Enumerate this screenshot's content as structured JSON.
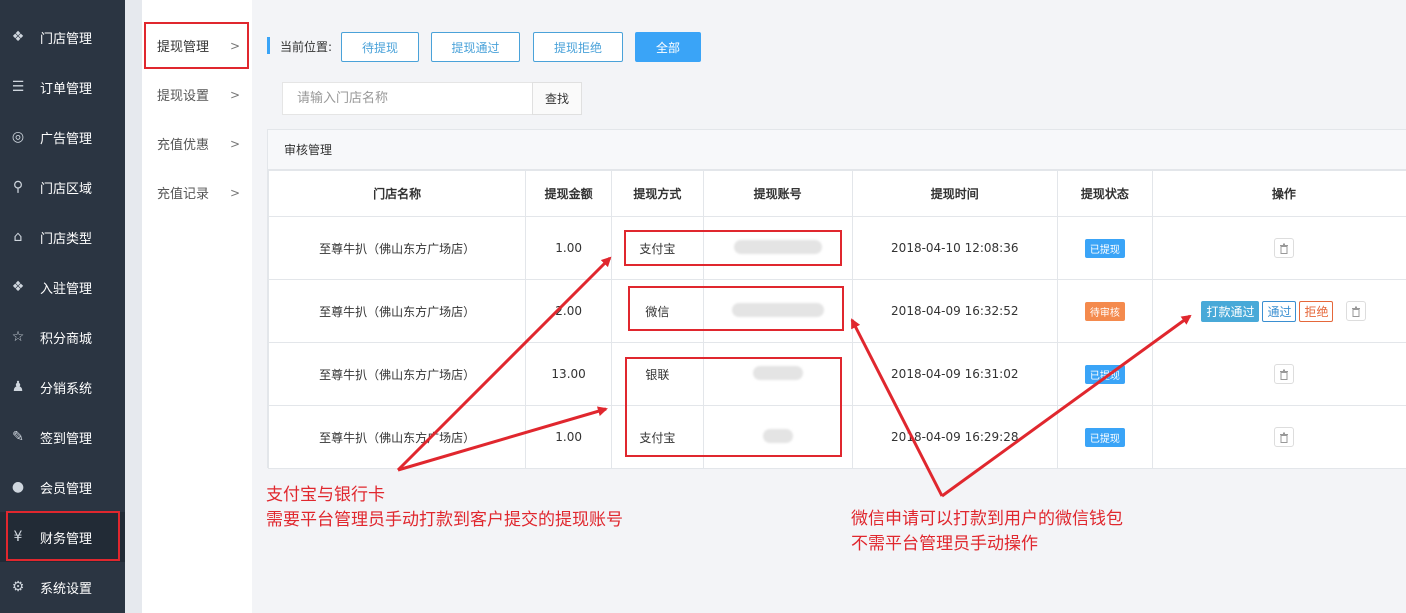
{
  "sidebar": {
    "items": [
      {
        "icon": "cubes-icon",
        "label": "门店管理"
      },
      {
        "icon": "list-icon",
        "label": "订单管理"
      },
      {
        "icon": "lifebuoy-icon",
        "label": "广告管理"
      },
      {
        "icon": "map-marker-icon",
        "label": "门店区域"
      },
      {
        "icon": "bank-icon",
        "label": "门店类型"
      },
      {
        "icon": "cubes-icon",
        "label": "入驻管理"
      },
      {
        "icon": "star-icon",
        "label": "积分商城"
      },
      {
        "icon": "users-icon",
        "label": "分销系统"
      },
      {
        "icon": "edit-icon",
        "label": "签到管理"
      },
      {
        "icon": "user-icon",
        "label": "会员管理"
      },
      {
        "icon": "yen-icon",
        "label": "财务管理"
      },
      {
        "icon": "gear-icon",
        "label": "系统设置"
      }
    ]
  },
  "subnav": {
    "items": [
      {
        "label": "提现管理"
      },
      {
        "label": "提现设置"
      },
      {
        "label": "充值优惠"
      },
      {
        "label": "充值记录"
      }
    ]
  },
  "filter": {
    "label": "当前位置:",
    "buttons": [
      "待提现",
      "提现通过",
      "提现拒绝",
      "全部"
    ]
  },
  "search": {
    "placeholder": "请输入门店名称",
    "button": "查找"
  },
  "panel": {
    "title": "审核管理",
    "columns": [
      "门店名称",
      "提现金额",
      "提现方式",
      "提现账号",
      "提现时间",
      "提现状态",
      "操作"
    ],
    "rows": [
      {
        "store": "至尊牛扒（佛山东方广场店）",
        "amount": "1.00",
        "method": "支付宝",
        "time": "2018-04-10 12:08:36",
        "status": "已提现"
      },
      {
        "store": "至尊牛扒（佛山东方广场店）",
        "amount": "2.00",
        "method": "微信",
        "time": "2018-04-09 16:32:52",
        "status": "待审核"
      },
      {
        "store": "至尊牛扒（佛山东方广场店）",
        "amount": "13.00",
        "method": "银联",
        "time": "2018-04-09 16:31:02",
        "status": "已提现"
      },
      {
        "store": "至尊牛扒（佛山东方广场店）",
        "amount": "1.00",
        "method": "支付宝",
        "time": "2018-04-09 16:29:28",
        "status": "已提现"
      }
    ],
    "actions": {
      "pay": "打款通过",
      "pass": "通过",
      "reject": "拒绝"
    }
  },
  "annotations": {
    "left_line1": "支付宝与银行卡",
    "left_line2": "需要平台管理员手动打款到客户提交的提现账号",
    "right_line1": "微信申请可以打款到用户的微信钱包",
    "right_line2": "不需平台管理员手动操作"
  },
  "colors": {
    "accent": "#3aa4f7",
    "sidebar": "#2b3542",
    "annotation": "#e0272e"
  }
}
